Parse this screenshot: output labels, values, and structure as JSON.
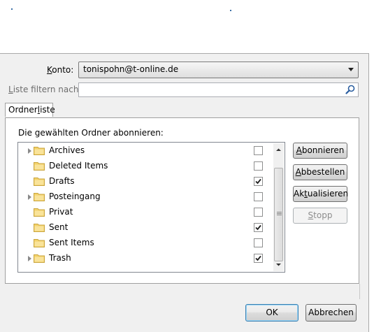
{
  "account": {
    "label_underlined": "K",
    "label_rest": "onto:",
    "selected": "tonispohn@t-online.de"
  },
  "filter": {
    "label_underlined": "L",
    "label_rest": "iste filtern nach:",
    "value": ""
  },
  "tab": {
    "label_prefix": "Ordner",
    "label_underlined": "l",
    "label_suffix": "iste"
  },
  "list_heading": "Die gewählten Ordner abonnieren:",
  "folders": [
    {
      "name": "Archives",
      "expandable": true,
      "subscribed": false
    },
    {
      "name": "Deleted Items",
      "expandable": false,
      "subscribed": false
    },
    {
      "name": "Drafts",
      "expandable": false,
      "subscribed": true
    },
    {
      "name": "Posteingang",
      "expandable": true,
      "subscribed": false
    },
    {
      "name": "Privat",
      "expandable": false,
      "subscribed": false
    },
    {
      "name": "Sent",
      "expandable": false,
      "subscribed": true
    },
    {
      "name": "Sent Items",
      "expandable": false,
      "subscribed": false
    },
    {
      "name": "Trash",
      "expandable": true,
      "subscribed": true
    }
  ],
  "buttons": {
    "subscribe": {
      "u": "A",
      "rest": "bonnieren"
    },
    "unsubscribe": {
      "u": "A",
      "rest": "bbestellen"
    },
    "refresh": {
      "pre": "Ak",
      "u": "t",
      "rest": "ualisieren"
    },
    "stop": {
      "pre": "",
      "u": "S",
      "rest": "topp"
    },
    "ok": "OK",
    "cancel": "Abbrechen"
  },
  "colors": {
    "dialog_bg": "#f0f0f0",
    "folder_yellow": "#f3d26b",
    "accent_blue": "#3c7fb1"
  }
}
